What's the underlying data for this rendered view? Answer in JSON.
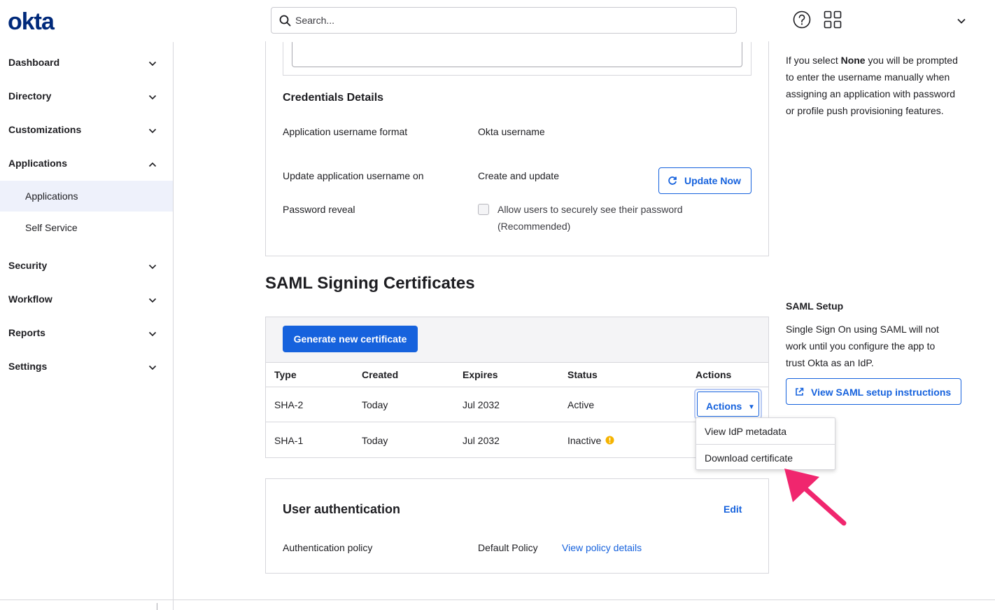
{
  "header": {
    "logo": "okta",
    "search_placeholder": "Search..."
  },
  "sidebar": {
    "items": [
      {
        "label": "Dashboard",
        "expanded": false
      },
      {
        "label": "Directory",
        "expanded": false
      },
      {
        "label": "Customizations",
        "expanded": false
      },
      {
        "label": "Applications",
        "expanded": true
      },
      {
        "label": "Security",
        "expanded": false
      },
      {
        "label": "Workflow",
        "expanded": false
      },
      {
        "label": "Reports",
        "expanded": false
      },
      {
        "label": "Settings",
        "expanded": false
      }
    ],
    "sub_items": [
      {
        "label": "Applications",
        "active": true
      },
      {
        "label": "Self Service",
        "active": false
      }
    ]
  },
  "credentials": {
    "title": "Credentials Details",
    "username_format_label": "Application username format",
    "username_format_value": "Okta username",
    "update_on_label": "Update application username on",
    "update_on_value": "Create and update",
    "update_now_button": "Update Now",
    "password_reveal_label": "Password reveal",
    "password_reveal_option_line1": "Allow users to securely see their password",
    "password_reveal_option_line2": "(Recommended)"
  },
  "certificates": {
    "title": "SAML Signing Certificates",
    "generate_button": "Generate new certificate",
    "columns": [
      "Type",
      "Created",
      "Expires",
      "Status",
      "Actions"
    ],
    "rows": [
      {
        "type": "SHA-2",
        "created": "Today",
        "expires": "Jul 2032",
        "status": "Active"
      },
      {
        "type": "SHA-1",
        "created": "Today",
        "expires": "Jul 2032",
        "status": "Inactive"
      }
    ],
    "actions_button": "Actions",
    "actions_caret": "▼",
    "menu": [
      "View IdP metadata",
      "Download certificate"
    ]
  },
  "user_auth": {
    "title": "User authentication",
    "edit_link": "Edit",
    "policy_label": "Authentication policy",
    "policy_value": "Default Policy",
    "policy_link": "View policy details"
  },
  "right_panel": {
    "note_prefix": "If you select ",
    "note_bold": "None",
    "note_line1_suffix": " you will be prompted",
    "note_line2": "to enter the username manually when",
    "note_line3": "assigning an application with password",
    "note_line4": "or profile push provisioning features.",
    "saml_setup_title": "SAML Setup",
    "saml_setup_line1": "Single Sign On using SAML will not",
    "saml_setup_line2": "work until you configure the app to",
    "saml_setup_line3": "trust Okta as an IdP.",
    "saml_setup_button": "View SAML setup instructions"
  },
  "colors": {
    "brand": "#00297a",
    "accent": "#1662dd",
    "warning": "#f5b300",
    "annotation_arrow": "#f0266e"
  }
}
